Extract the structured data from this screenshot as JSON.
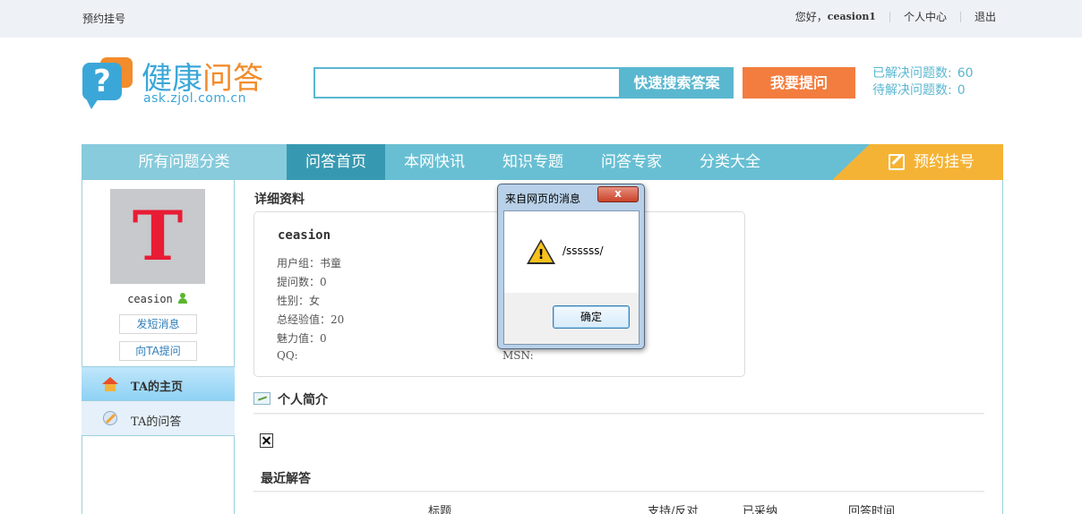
{
  "topbar": {
    "left_link": "预约挂号",
    "greeting": "您好，",
    "username": "ceasion1",
    "personal_center": "个人中心",
    "logout": "退出"
  },
  "header": {
    "logo_title_a": "健康",
    "logo_title_b": "问答",
    "logo_domain": "ask.zjol.com.cn",
    "logo_q": "?",
    "search_value": "",
    "search_button": "快速搜索答案",
    "ask_button": "我要提问",
    "solved_label": "已解决问题数:",
    "solved_count": "60",
    "pending_label": "待解决问题数:",
    "pending_count": "0"
  },
  "nav": {
    "all_categories": "所有问题分类",
    "items": [
      "问答首页",
      "本网快讯",
      "知识专题",
      "问答专家",
      "分类大全"
    ],
    "active_index": 0,
    "register": "预约挂号"
  },
  "sidebar": {
    "avatar_letter": "T",
    "username": "ceasion",
    "send_message": "发短消息",
    "ask_ta": "向TA提问",
    "nav_home": "TA的主页",
    "nav_answers": "TA的问答"
  },
  "profile": {
    "section_title": "详细资料",
    "name": "ceasion",
    "user_group": "用户组：书童",
    "question_count": "提问数：0",
    "gender": "性别：女",
    "total_exp": "总经验值：20",
    "charm": "魅力值：0",
    "qq": "QQ:",
    "msn": "MSN:"
  },
  "intro": {
    "section_title": "个人简介"
  },
  "recent": {
    "section_title": "最近解答",
    "columns": [
      "标题",
      "支持/反对",
      "已采纳",
      "回答时间"
    ]
  },
  "dialog": {
    "title": "来自网页的消息",
    "close": "x",
    "message": "/ssssss/",
    "ok": "确定"
  },
  "colors": {
    "accent": "#68bfd3",
    "nav_active": "#3799b1",
    "ask_button": "#f27d3f",
    "register": "#f5b335",
    "avatar_letter": "#e81c34"
  }
}
